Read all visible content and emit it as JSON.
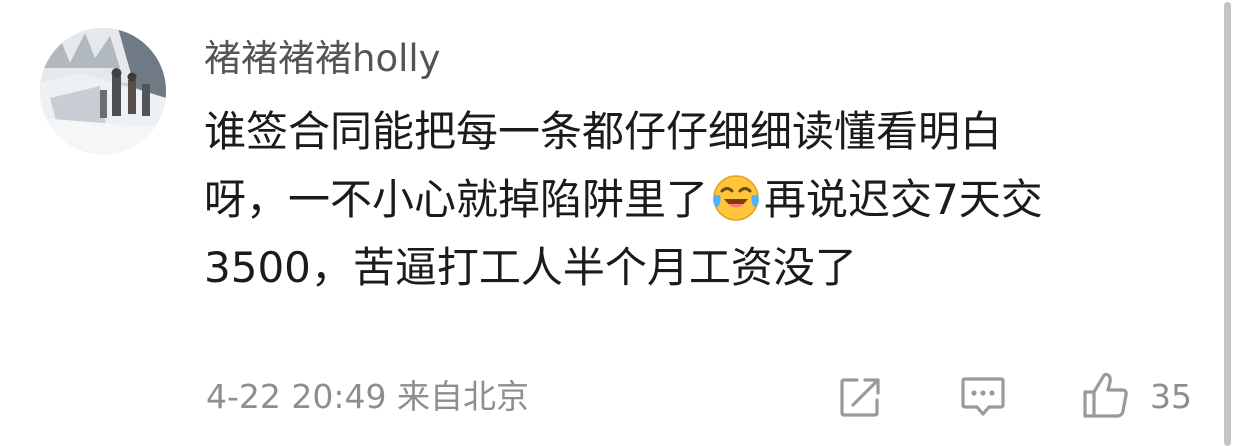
{
  "comment": {
    "username": "褚褚褚褚holly",
    "content_lines": [
      "谁签合同能把每一条都仔仔细细读懂看明白",
      "呀，一不小心就掉陷阱里了",
      "再说迟交7天交",
      "3500，苦逼打工人半个月工资没了"
    ],
    "emoji": "laughing-crying-emoji",
    "timestamp": "4-22 20:49",
    "location": "来自北京",
    "like_count": "35"
  },
  "icons": {
    "share": "share-icon",
    "reply": "comment-icon",
    "like": "thumbs-up-icon"
  }
}
